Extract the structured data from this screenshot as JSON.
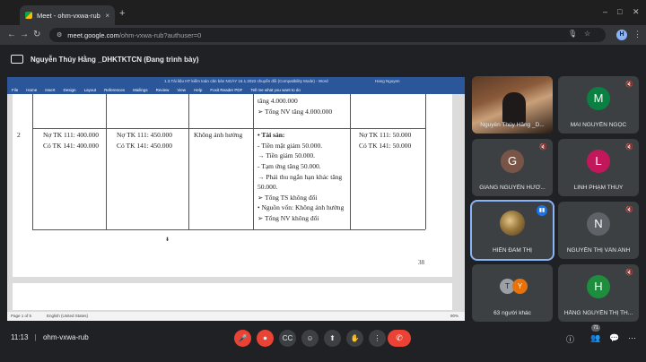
{
  "browser": {
    "tab_title": "Meet - ohm-vxwa-rub",
    "close_glyph": "×",
    "new_tab_glyph": "+",
    "url_host": "meet.google.com",
    "url_path": "/ohm-vxwa-rub?authuser=0",
    "profile_initial": "H",
    "icons": [
      "back-icon",
      "forward-icon",
      "reload-icon",
      "site-info-icon",
      "mic-icon",
      "star-icon",
      "menu-icon"
    ]
  },
  "presenter": {
    "label": "Nguyễn Thúy Hằng _DHKTKTCN (Đang trình bày)"
  },
  "word": {
    "doc_title": "1.3.Tài liệu HT kiểm toán căn bản NGÀY 16.1.2022 chuyển đổi (Compatibility Mode) - Word",
    "user_name": "Hang Nguyen",
    "ribbon": [
      "File",
      "Home",
      "Insert",
      "Design",
      "Layout",
      "References",
      "Mailings",
      "Review",
      "View",
      "Help",
      "Foxit Reader PDF",
      "Tell me what you want to do"
    ],
    "status_page": "Page 1 of 5",
    "status_lang": "English (United States)",
    "zoom": "90%",
    "page_number": "38",
    "table": {
      "top_row": {
        "line1": "tăng 4.000.000",
        "line2": "➢  Tổng NV tăng 4.000.000"
      },
      "row2": {
        "stt": "2",
        "col_a": [
          "Nợ TK 111: 400.000",
          "Có TK 141: 400.000"
        ],
        "col_b": [
          "Nợ TK 111: 450.000",
          "Có TK 141: 450.000"
        ],
        "col_c": "Không ảnh hưởng",
        "col_d": [
          "• Tài sản:",
          "- Tiền mặt giảm 50.000.",
          "→ Tiền giảm 50.000.",
          "- Tạm ứng tăng 50.000.",
          "→ Phải thu ngắn hạn khác tăng",
          "50.000.",
          "➢  Tổng TS không đổi",
          "• Nguồn vốn: Không ảnh hưởng",
          "➢  Tổng NV không đổi"
        ],
        "col_e": [
          "Nợ TK 111: 50.000",
          "Có TK 141: 50.000"
        ]
      }
    }
  },
  "participants": [
    {
      "name": "Nguyễn Thúy Hằng _D...",
      "type": "video-person"
    },
    {
      "name": "MAI NGUYỄN NGỌC",
      "initial": "M",
      "color": "#0b8043"
    },
    {
      "name": "GIANG NGUYỄN HƯƠ...",
      "initial": "G",
      "color": "#795548"
    },
    {
      "name": "LINH PHẠM THÙY",
      "initial": "L",
      "color": "#c2185b"
    },
    {
      "name": "HIỀN ĐÀM THỊ",
      "type": "photo-avatar",
      "speaking": true
    },
    {
      "name": "NGUYỄN THỊ VÂN ANH",
      "initial": "N",
      "color": "#5f6368"
    },
    {
      "name": "63 người khác",
      "type": "others",
      "dots": [
        {
          "initial": "T",
          "color": "#9aa0a6"
        },
        {
          "initial": "Y",
          "color": "#e8710a"
        }
      ]
    },
    {
      "name": "HẰNG NGUYỄN THỊ TH...",
      "initial": "H",
      "color": "#1e8e3e"
    }
  ],
  "bottom": {
    "time": "11:13",
    "separator": "|",
    "meeting_code": "ohm-vxwa-rub",
    "participant_count": "71",
    "mic_glyph": "🎤",
    "cam_glyph": "⏺",
    "cc_glyph": "CC",
    "emoji_glyph": "☺",
    "present_glyph": "⬆",
    "hand_glyph": "✋",
    "more_glyph": "⋮",
    "hangup_glyph": "✆",
    "info_glyph": "ⓘ",
    "people_glyph": "👥",
    "chat_glyph": "💬",
    "activities_glyph": "⋯"
  }
}
